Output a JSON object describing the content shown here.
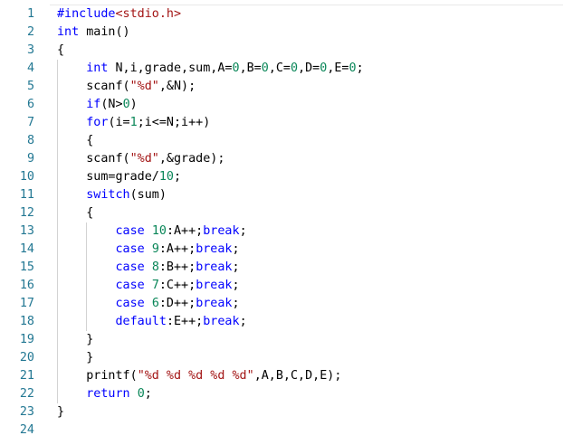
{
  "editor": {
    "lines": [
      {
        "num": "1",
        "tokens": [
          {
            "t": "#include",
            "c": "pp"
          },
          {
            "t": "<stdio.h>",
            "c": "hdr"
          }
        ]
      },
      {
        "num": "2",
        "tokens": [
          {
            "t": "int",
            "c": "kw"
          },
          {
            "t": " main()",
            "c": ""
          }
        ]
      },
      {
        "num": "3",
        "tokens": [
          {
            "t": "{",
            "c": ""
          }
        ]
      },
      {
        "num": "4",
        "tokens": [
          {
            "t": "    ",
            "c": ""
          },
          {
            "t": "int",
            "c": "kw"
          },
          {
            "t": " N,i,grade,sum,A=",
            "c": ""
          },
          {
            "t": "0",
            "c": "num"
          },
          {
            "t": ",B=",
            "c": ""
          },
          {
            "t": "0",
            "c": "num"
          },
          {
            "t": ",C=",
            "c": ""
          },
          {
            "t": "0",
            "c": "num"
          },
          {
            "t": ",D=",
            "c": ""
          },
          {
            "t": "0",
            "c": "num"
          },
          {
            "t": ",E=",
            "c": ""
          },
          {
            "t": "0",
            "c": "num"
          },
          {
            "t": ";",
            "c": ""
          }
        ]
      },
      {
        "num": "5",
        "tokens": [
          {
            "t": "    scanf(",
            "c": ""
          },
          {
            "t": "\"%d\"",
            "c": "str"
          },
          {
            "t": ",&N);",
            "c": ""
          }
        ]
      },
      {
        "num": "6",
        "tokens": [
          {
            "t": "    ",
            "c": ""
          },
          {
            "t": "if",
            "c": "kw"
          },
          {
            "t": "(N>",
            "c": ""
          },
          {
            "t": "0",
            "c": "num"
          },
          {
            "t": ")",
            "c": ""
          }
        ]
      },
      {
        "num": "7",
        "tokens": [
          {
            "t": "    ",
            "c": ""
          },
          {
            "t": "for",
            "c": "kw"
          },
          {
            "t": "(i=",
            "c": ""
          },
          {
            "t": "1",
            "c": "num"
          },
          {
            "t": ";i<=N;i++)",
            "c": ""
          }
        ]
      },
      {
        "num": "8",
        "tokens": [
          {
            "t": "    {",
            "c": ""
          }
        ]
      },
      {
        "num": "9",
        "tokens": [
          {
            "t": "    scanf(",
            "c": ""
          },
          {
            "t": "\"%d\"",
            "c": "str"
          },
          {
            "t": ",&grade);",
            "c": ""
          }
        ]
      },
      {
        "num": "10",
        "tokens": [
          {
            "t": "    sum=grade/",
            "c": ""
          },
          {
            "t": "10",
            "c": "num"
          },
          {
            "t": ";",
            "c": ""
          }
        ]
      },
      {
        "num": "11",
        "tokens": [
          {
            "t": "    ",
            "c": ""
          },
          {
            "t": "switch",
            "c": "kw"
          },
          {
            "t": "(sum)",
            "c": ""
          }
        ]
      },
      {
        "num": "12",
        "tokens": [
          {
            "t": "    {",
            "c": ""
          }
        ]
      },
      {
        "num": "13",
        "tokens": [
          {
            "t": "        ",
            "c": ""
          },
          {
            "t": "case",
            "c": "kw"
          },
          {
            "t": " ",
            "c": ""
          },
          {
            "t": "10",
            "c": "num"
          },
          {
            "t": ":A++;",
            "c": ""
          },
          {
            "t": "break",
            "c": "kw"
          },
          {
            "t": ";",
            "c": ""
          }
        ]
      },
      {
        "num": "14",
        "tokens": [
          {
            "t": "        ",
            "c": ""
          },
          {
            "t": "case",
            "c": "kw"
          },
          {
            "t": " ",
            "c": ""
          },
          {
            "t": "9",
            "c": "num"
          },
          {
            "t": ":A++;",
            "c": ""
          },
          {
            "t": "break",
            "c": "kw"
          },
          {
            "t": ";",
            "c": ""
          }
        ]
      },
      {
        "num": "15",
        "tokens": [
          {
            "t": "        ",
            "c": ""
          },
          {
            "t": "case",
            "c": "kw"
          },
          {
            "t": " ",
            "c": ""
          },
          {
            "t": "8",
            "c": "num"
          },
          {
            "t": ":B++;",
            "c": ""
          },
          {
            "t": "break",
            "c": "kw"
          },
          {
            "t": ";",
            "c": ""
          }
        ]
      },
      {
        "num": "16",
        "tokens": [
          {
            "t": "        ",
            "c": ""
          },
          {
            "t": "case",
            "c": "kw"
          },
          {
            "t": " ",
            "c": ""
          },
          {
            "t": "7",
            "c": "num"
          },
          {
            "t": ":C++;",
            "c": ""
          },
          {
            "t": "break",
            "c": "kw"
          },
          {
            "t": ";",
            "c": ""
          }
        ]
      },
      {
        "num": "17",
        "tokens": [
          {
            "t": "        ",
            "c": ""
          },
          {
            "t": "case",
            "c": "kw"
          },
          {
            "t": " ",
            "c": ""
          },
          {
            "t": "6",
            "c": "num"
          },
          {
            "t": ":D++;",
            "c": ""
          },
          {
            "t": "break",
            "c": "kw"
          },
          {
            "t": ";",
            "c": ""
          }
        ]
      },
      {
        "num": "18",
        "tokens": [
          {
            "t": "        ",
            "c": ""
          },
          {
            "t": "default",
            "c": "kw"
          },
          {
            "t": ":E++;",
            "c": ""
          },
          {
            "t": "break",
            "c": "kw"
          },
          {
            "t": ";",
            "c": ""
          }
        ]
      },
      {
        "num": "19",
        "tokens": [
          {
            "t": "    }",
            "c": ""
          }
        ]
      },
      {
        "num": "20",
        "tokens": [
          {
            "t": "    }",
            "c": ""
          }
        ]
      },
      {
        "num": "21",
        "tokens": [
          {
            "t": "    printf(",
            "c": ""
          },
          {
            "t": "\"%d %d %d %d %d\"",
            "c": "str"
          },
          {
            "t": ",A,B,C,D,E);",
            "c": ""
          }
        ]
      },
      {
        "num": "22",
        "tokens": [
          {
            "t": "    ",
            "c": ""
          },
          {
            "t": "return",
            "c": "kw"
          },
          {
            "t": " ",
            "c": ""
          },
          {
            "t": "0",
            "c": "num"
          },
          {
            "t": ";",
            "c": ""
          }
        ]
      },
      {
        "num": "23",
        "tokens": [
          {
            "t": "}",
            "c": ""
          }
        ]
      },
      {
        "num": "24",
        "tokens": []
      }
    ]
  },
  "colors": {
    "line_number": "#237893",
    "keyword": "#0000ff",
    "number": "#098658",
    "string": "#a31515",
    "plain": "#000000",
    "indent_guide": "#d3d3d3"
  }
}
